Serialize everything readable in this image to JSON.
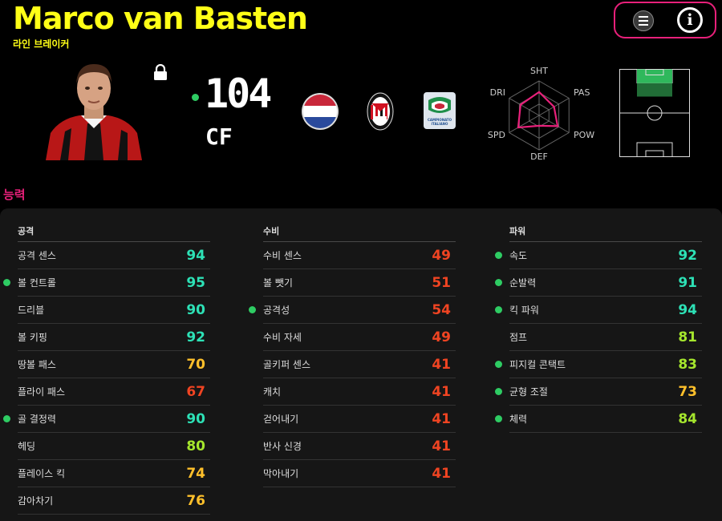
{
  "player": {
    "name": "Marco van Basten",
    "playstyle": "라인 브레이커",
    "rating": "104",
    "position": "CF"
  },
  "icons": {
    "menu": "menu-icon",
    "info": "info-icon",
    "lock": "lock-icon",
    "flag": "netherlands-flag-icon",
    "club": "ac-milan-crest-icon",
    "league": "serie-a-logo-icon"
  },
  "info_glyph": "i",
  "league_logo_text": "CAMPIONATO ITALIANO",
  "radar": {
    "labels": [
      "SHT",
      "PAS",
      "POW",
      "DEF",
      "SPD",
      "DRI"
    ]
  },
  "section_label": "능력",
  "colors": {
    "title": "#ffff17",
    "accent": "#e8207a",
    "dot": "#2ecc63",
    "v90": "#2de1b6",
    "v80": "#a5e62d",
    "v70": "#ffc02b",
    "v60": "#f04422"
  },
  "stats": {
    "attack": {
      "title": "공격",
      "rows": [
        {
          "name": "공격 센스",
          "value": "94",
          "dot": false
        },
        {
          "name": "볼 컨트롤",
          "value": "95",
          "dot": true
        },
        {
          "name": "드리블",
          "value": "90",
          "dot": false
        },
        {
          "name": "볼 키핑",
          "value": "92",
          "dot": false
        },
        {
          "name": "땅볼 패스",
          "value": "70",
          "dot": false
        },
        {
          "name": "플라이 패스",
          "value": "67",
          "dot": false
        },
        {
          "name": "골 결정력",
          "value": "90",
          "dot": true
        },
        {
          "name": "헤딩",
          "value": "80",
          "dot": false
        },
        {
          "name": "플레이스 킥",
          "value": "74",
          "dot": false
        },
        {
          "name": "감아차기",
          "value": "76",
          "dot": false
        }
      ]
    },
    "defense": {
      "title": "수비",
      "rows": [
        {
          "name": "수비 센스",
          "value": "49",
          "dot": false
        },
        {
          "name": "볼 뺏기",
          "value": "51",
          "dot": false
        },
        {
          "name": "공격성",
          "value": "54",
          "dot": true
        },
        {
          "name": "수비 자세",
          "value": "49",
          "dot": false
        },
        {
          "name": "골키퍼 센스",
          "value": "41",
          "dot": false
        },
        {
          "name": "캐치",
          "value": "41",
          "dot": false
        },
        {
          "name": "걷어내기",
          "value": "41",
          "dot": false
        },
        {
          "name": "반사 신경",
          "value": "41",
          "dot": false
        },
        {
          "name": "막아내기",
          "value": "41",
          "dot": false
        }
      ]
    },
    "power": {
      "title": "파워",
      "rows": [
        {
          "name": "속도",
          "value": "92",
          "dot": true
        },
        {
          "name": "순발력",
          "value": "91",
          "dot": true
        },
        {
          "name": "킥 파워",
          "value": "94",
          "dot": true
        },
        {
          "name": "점프",
          "value": "81",
          "dot": false
        },
        {
          "name": "피지컬 콘택트",
          "value": "83",
          "dot": true
        },
        {
          "name": "균형 조절",
          "value": "73",
          "dot": true
        },
        {
          "name": "체력",
          "value": "84",
          "dot": true
        }
      ]
    }
  }
}
